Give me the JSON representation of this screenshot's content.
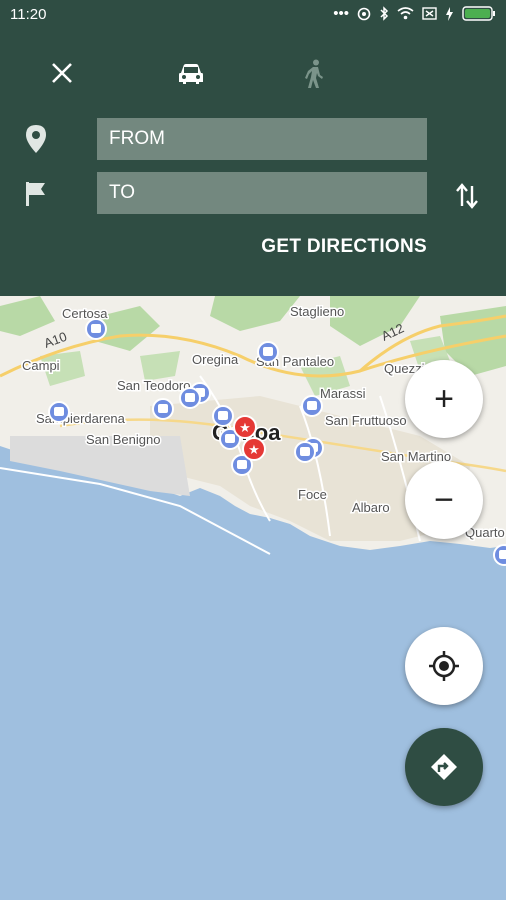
{
  "status_bar": {
    "time": "11:20"
  },
  "header": {
    "close_icon": "close-icon",
    "modes": [
      "car-icon",
      "walk-icon"
    ],
    "from_placeholder": "FROM",
    "to_placeholder": "TO",
    "get_directions_label": "GET DIRECTIONS"
  },
  "map": {
    "city_label": "Genoa",
    "places": [
      "Certosa",
      "Staglieno",
      "Campi",
      "Oregina",
      "San Pantaleo",
      "San Teodoro",
      "Marassi",
      "Quezzi",
      "Sampierdarena",
      "San Benigno",
      "San Fruttuoso",
      "San Martino",
      "Foce",
      "Albaro",
      "Quarto"
    ],
    "roads": [
      "A10",
      "A12"
    ]
  },
  "controls": {
    "zoom_in": "+",
    "zoom_out": "−"
  },
  "colors": {
    "header": "#2f4d43",
    "field": "#73887f",
    "water": "#9fbfdf",
    "marker_blue": "#6f8de0",
    "marker_red": "#e53935"
  }
}
